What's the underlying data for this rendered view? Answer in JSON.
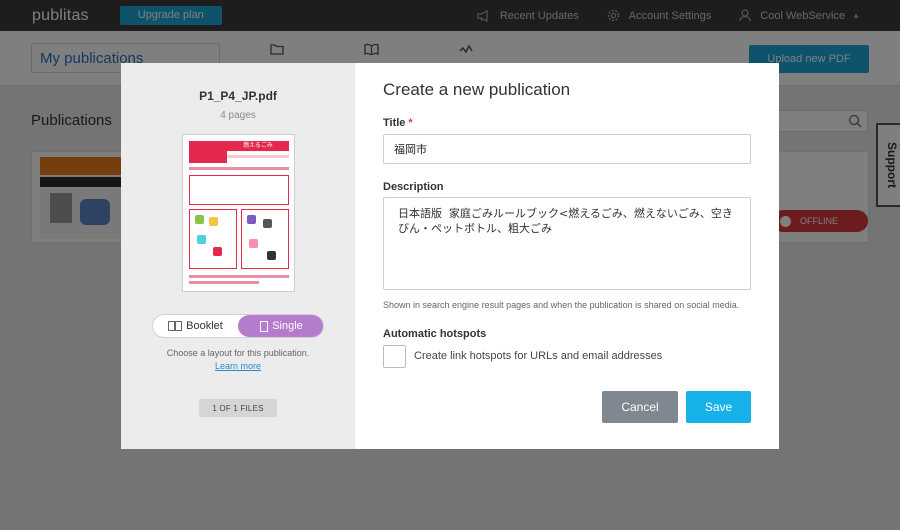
{
  "topbar": {
    "logo": "publitas",
    "upgrade_label": "Upgrade plan",
    "nav": [
      {
        "label": "Recent Updates",
        "icon": "megaphone-icon"
      },
      {
        "label": "Account Settings",
        "icon": "gear-icon"
      },
      {
        "label": "Cool WebService",
        "icon": "user-icon"
      }
    ]
  },
  "subheader": {
    "my_publications": "My publications",
    "upload_label": "Upload new PDF",
    "icons": [
      "folder-icon",
      "book-icon",
      "activity-icon"
    ]
  },
  "page": {
    "publications_heading": "Publications",
    "publication": {
      "status": "OFFLINE"
    }
  },
  "support": {
    "label": "Support"
  },
  "modal": {
    "file": {
      "name": "P1_P4_JP.pdf",
      "pages": "4 pages",
      "preview_title": "燃えるごみ"
    },
    "layout": {
      "options": [
        {
          "label": "Booklet",
          "active": false
        },
        {
          "label": "Single",
          "active": true
        }
      ],
      "hint": "Choose a layout for this publication.",
      "learn_more": "Learn more"
    },
    "files_badge": "1 OF 1 FILES",
    "title": "Create a new publication",
    "fields": {
      "title_label": "Title",
      "title_required_mark": "*",
      "title_value": "福岡市",
      "description_label": "Description",
      "description_value": "日本語版  家庭ごみルールブック<燃えるごみ、燃えないごみ、空きびん・ペットボトル、粗大ごみ",
      "description_hint": "Shown in search engine result pages and when the publication is shared on social media.",
      "hotspots_label": "Automatic hotspots",
      "hotspots_checkbox_label": "Create link hotspots for URLs and email addresses",
      "hotspots_checked": false
    },
    "buttons": {
      "cancel": "Cancel",
      "save": "Save"
    }
  }
}
